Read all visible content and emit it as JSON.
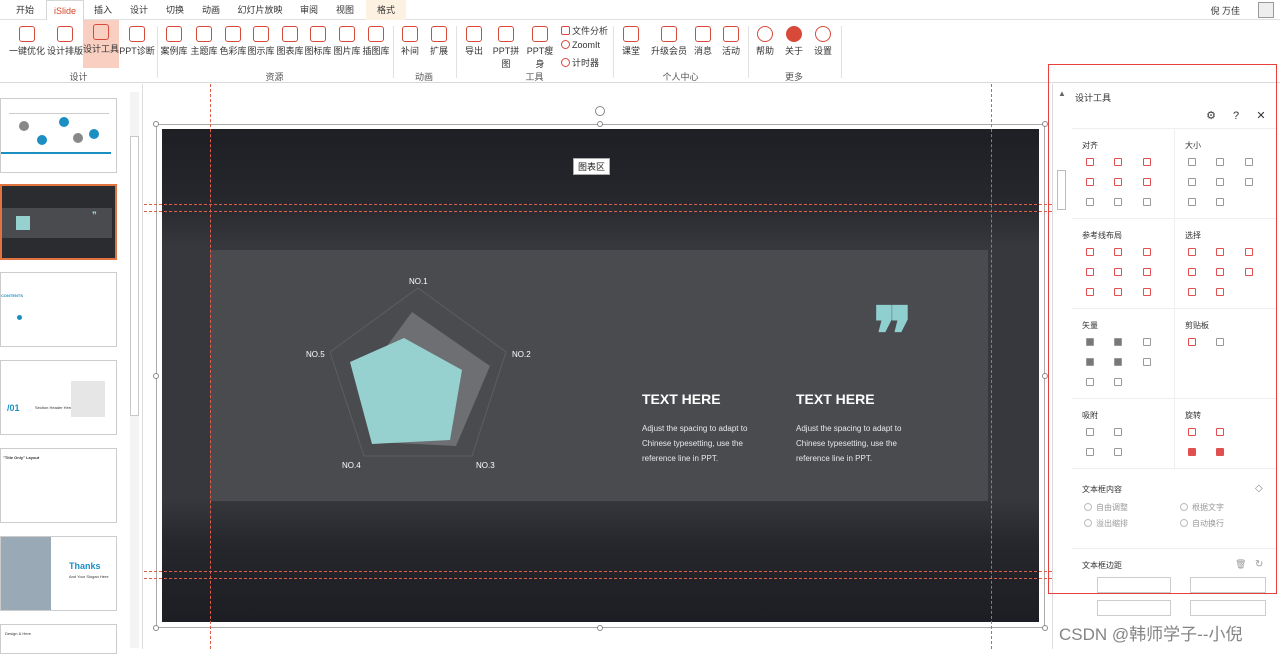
{
  "tabs": [
    "开始",
    "iSlide",
    "插入",
    "设计",
    "切换",
    "动画",
    "幻灯片放映",
    "审阅",
    "视图",
    "格式"
  ],
  "user": "倪 万佳",
  "ribbon": {
    "buttons": [
      "一键优化",
      "设计排版",
      "设计工具",
      "PPT诊断",
      "案例库",
      "主题库",
      "色彩库",
      "图示库",
      "图表库",
      "图标库",
      "图片库",
      "插图库",
      "补间",
      "扩展",
      "导出",
      "PPT拼图",
      "PPT瘦身",
      "课堂",
      "升级会员",
      "消息",
      "活动",
      "帮助",
      "关于",
      "设置"
    ],
    "small": [
      "文件分析",
      "ZoomIt",
      "计时器"
    ],
    "groups": [
      "设计",
      "资源",
      "动画",
      "工具",
      "个人中心",
      "更多"
    ]
  },
  "slide": {
    "chart_area_label": "图表区",
    "radar_labels": [
      "NO.1",
      "NO.2",
      "NO.3",
      "NO.4",
      "NO.5"
    ],
    "col1_heading": "TEXT HERE",
    "col1_body": "Adjust the spacing to adapt to Chinese typesetting, use the reference line in PPT.",
    "col2_heading": "TEXT HERE",
    "col2_body": "Adjust the spacing to adapt to Chinese typesetting, use the reference line in PPT.",
    "quote_mark": "❞",
    "accent": "#96d1d0"
  },
  "thumbs": {
    "contents": "CONTENTS",
    "section_no": "/01",
    "section_title": "Section Header Here",
    "title_only": "\"Title Only\" Layout",
    "thanks": "Thanks",
    "thanks_sub": "And Your Slogan Here",
    "design": "Design & Here"
  },
  "panel": {
    "title": "设计工具",
    "sections": [
      "对齐",
      "大小",
      "参考线布局",
      "选择",
      "矢量",
      "剪贴板",
      "吸附",
      "旋转"
    ],
    "textbox_content": "文本框内容",
    "options": [
      "自由调整",
      "根据文字",
      "溢出缩排",
      "自动换行"
    ],
    "textbox_margin": "文本框边距"
  },
  "watermark": "CSDN @韩师学子--小倪"
}
